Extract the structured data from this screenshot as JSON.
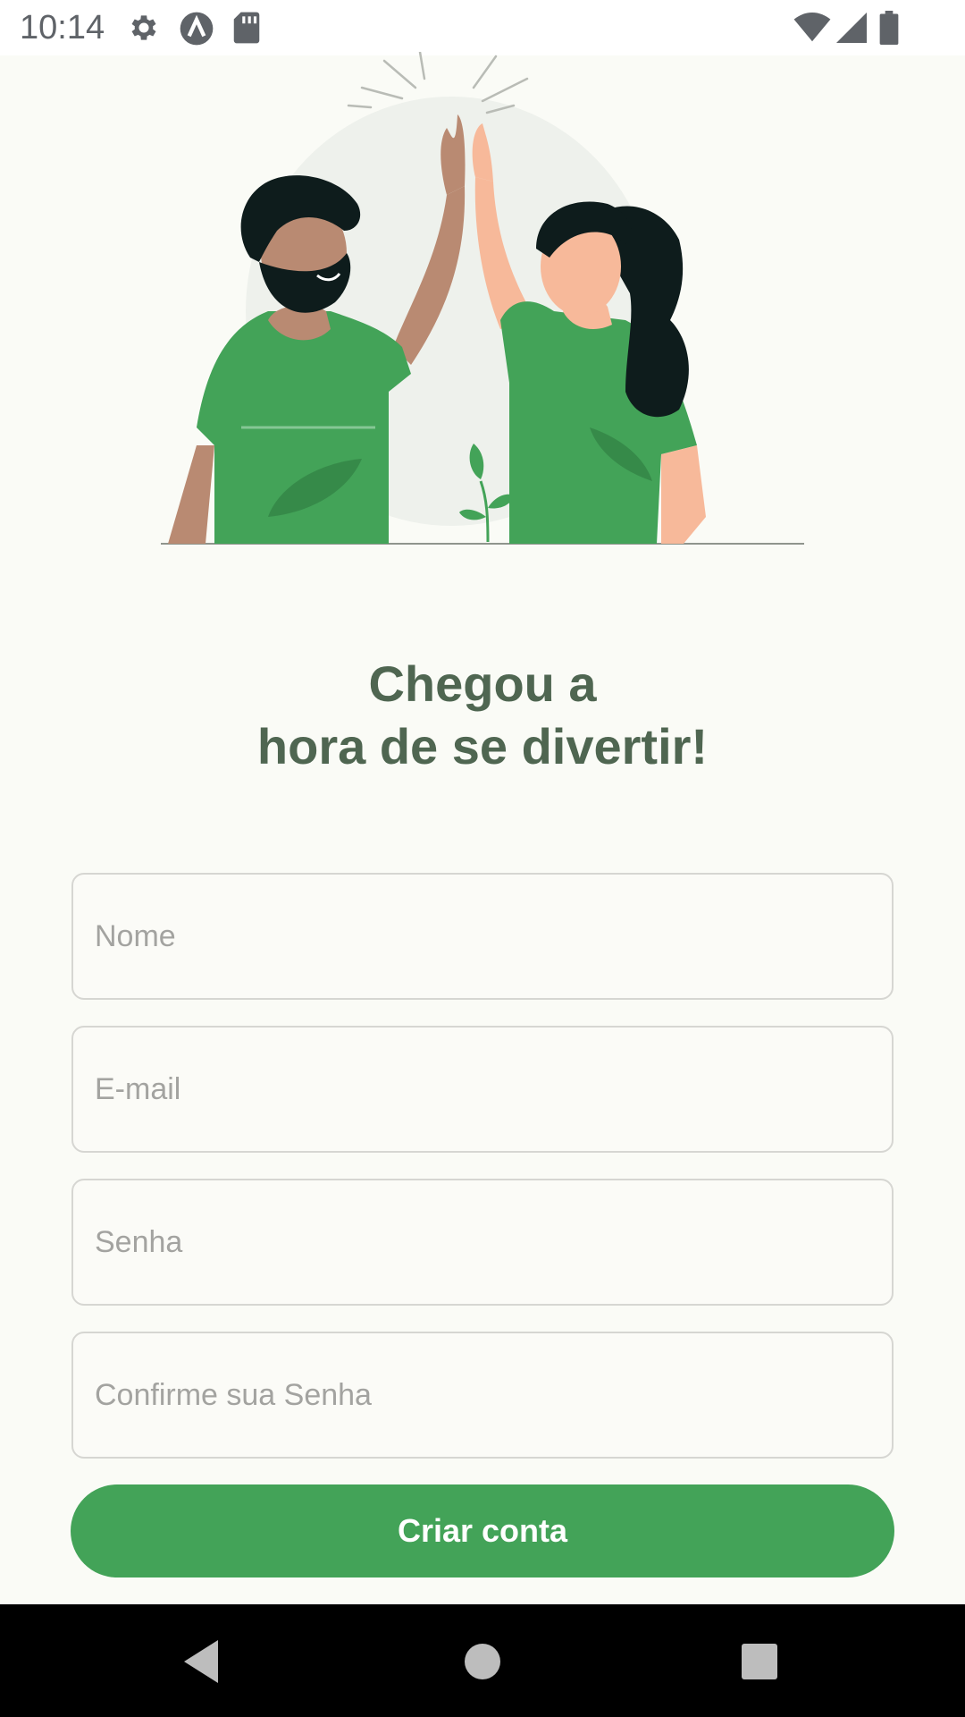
{
  "status_bar": {
    "time": "10:14",
    "icons": [
      "gear-icon",
      "app-a-icon",
      "sd-card-icon",
      "wifi-icon",
      "signal-icon",
      "battery-icon"
    ]
  },
  "illustration": {
    "description_icon": "high-five-illustration",
    "colors": {
      "shirt": "#43a358",
      "skin_man": "#b98a72",
      "skin_woman": "#f7b99a",
      "hair": "#0e1c1c",
      "circle": "#eef1ec"
    }
  },
  "heading": {
    "line1": "Chegou a",
    "line2": "hora de se divertir!"
  },
  "form": {
    "name_placeholder": "Nome",
    "email_placeholder": "E-mail",
    "password_placeholder": "Senha",
    "confirm_password_placeholder": "Confirme sua Senha",
    "submit_label": "Criar conta"
  },
  "nav_bar": {
    "icons": [
      "back-icon",
      "home-icon",
      "recents-icon"
    ]
  },
  "colors": {
    "accent": "#43a358",
    "heading": "#4f6651",
    "background": "#fafbf6"
  }
}
